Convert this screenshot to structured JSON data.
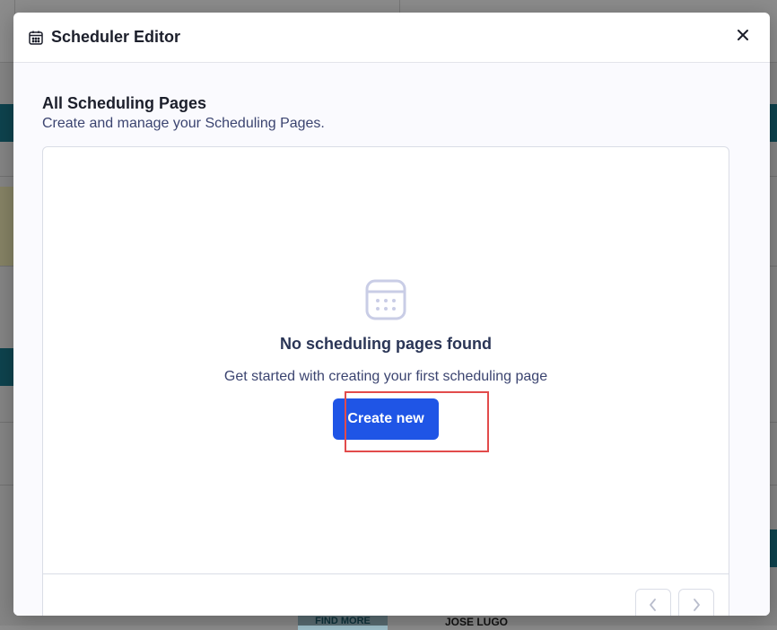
{
  "modal": {
    "title": "Scheduler Editor",
    "title_icon": "calendar-icon",
    "close_icon": "close-icon"
  },
  "section": {
    "title": "All Scheduling Pages",
    "subtitle": "Create and manage your Scheduling Pages."
  },
  "empty_state": {
    "icon": "calendar-icon",
    "title": "No scheduling pages found",
    "subtitle": "Get started with creating your first scheduling page",
    "button_label": "Create new"
  },
  "pagination": {
    "prev_icon": "chevron-left-icon",
    "next_icon": "chevron-right-icon"
  },
  "background": {
    "find_more_label": "FIND MORE",
    "name_label": "JOSE LUGO"
  },
  "colors": {
    "accent": "#1f55e6",
    "highlight": "#e24b4b",
    "background_teal": "#1a7a8e"
  }
}
